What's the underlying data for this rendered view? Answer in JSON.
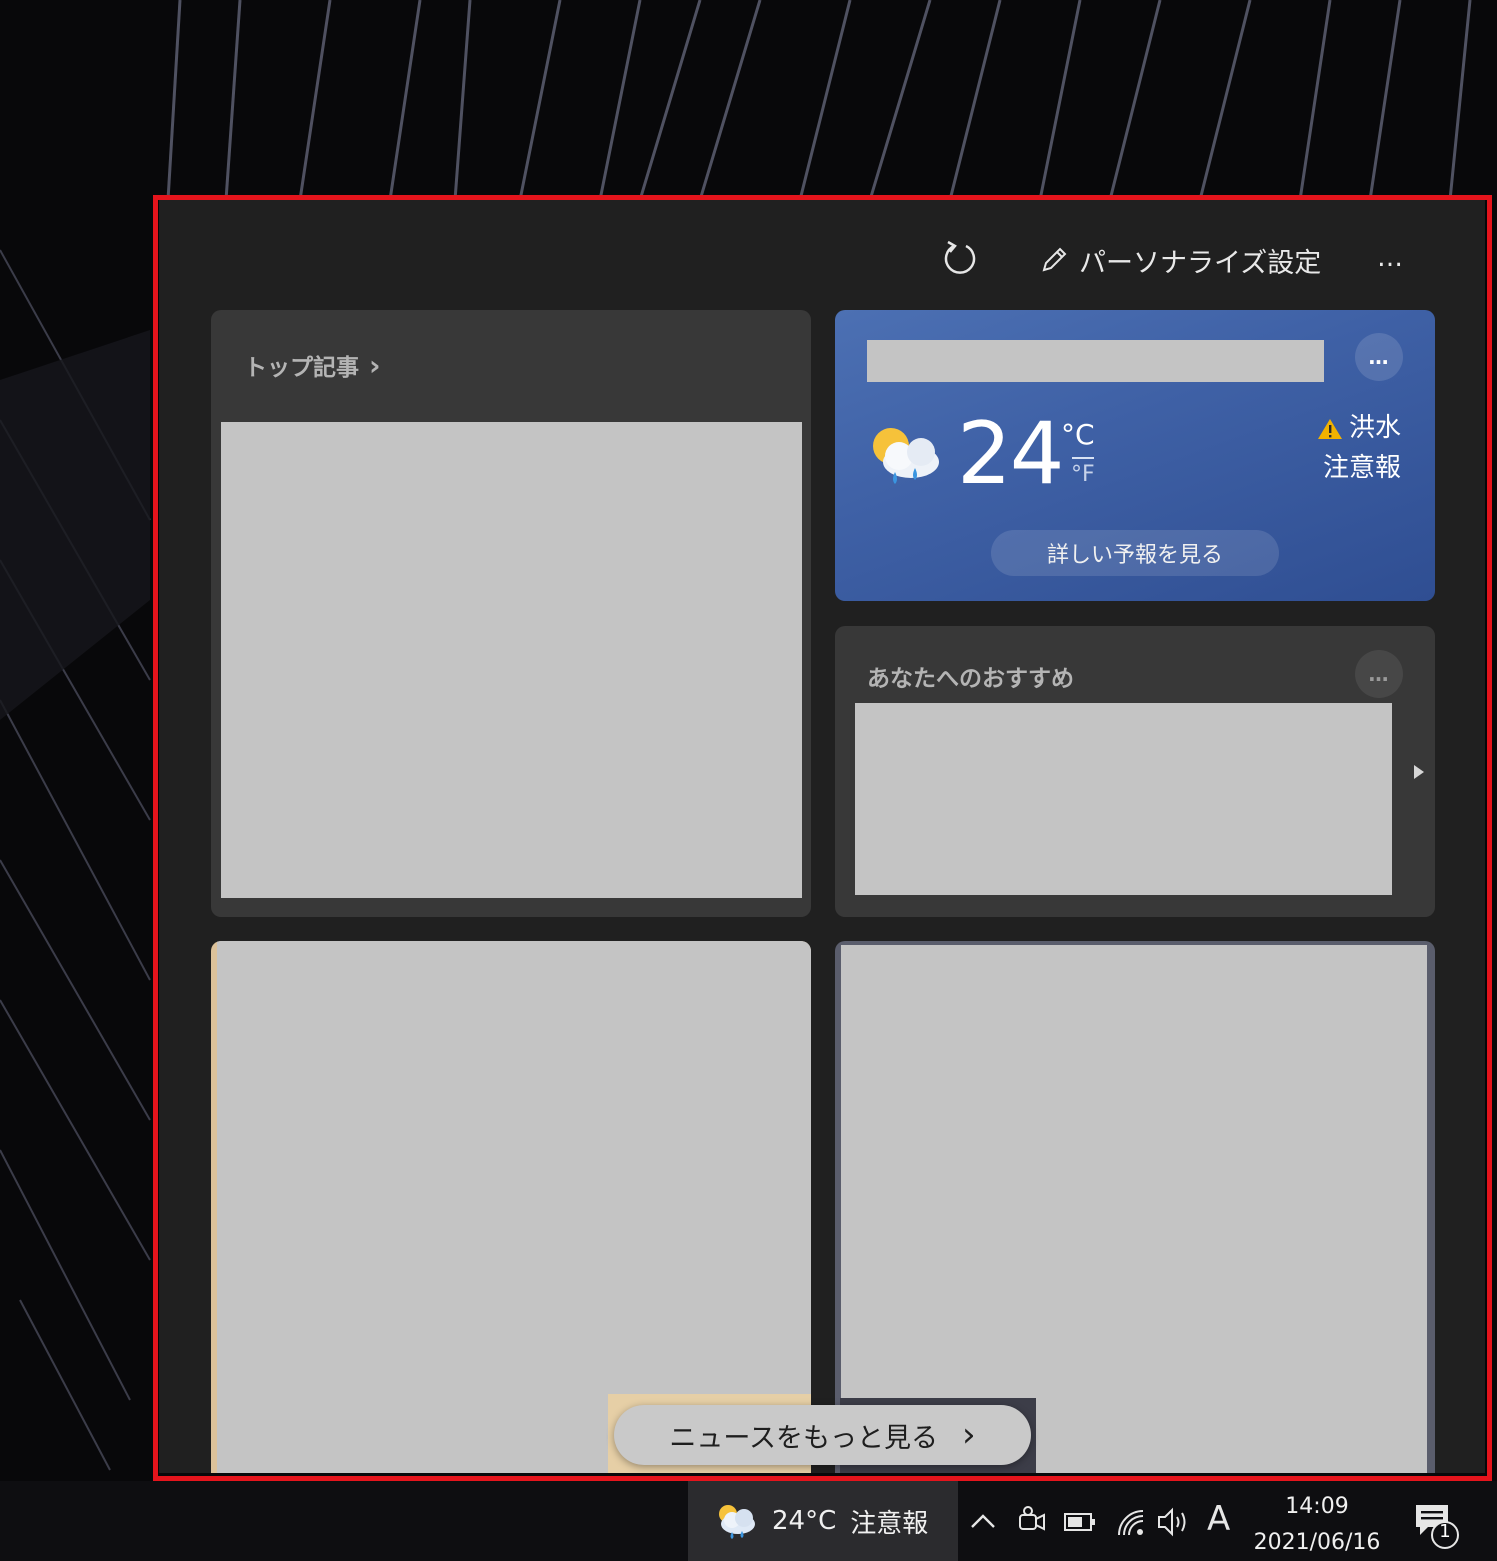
{
  "panel": {
    "personalize_label": "パーソナライズ設定",
    "more_label": "…"
  },
  "top_stories": {
    "title": "トップ記事",
    "chevron": "›"
  },
  "weather": {
    "temperature": "24",
    "unit_celsius": "°C",
    "unit_fahrenheit": "°F",
    "alert_line1": "洪水",
    "alert_line2": "注意報",
    "forecast_button": "詳しい予報を見る",
    "more_label": "…",
    "alert_color": "#f2b200"
  },
  "recommendations": {
    "title": "あなたへのおすすめ",
    "more_label": "…"
  },
  "more_news": {
    "label": "ニュースをもっと見る",
    "chevron": "›"
  },
  "taskbar": {
    "weather_temp": "24°C",
    "weather_alert": "注意報",
    "ime_label": "A",
    "time": "14:09",
    "date": "2021/06/16",
    "notification_count": "1"
  }
}
